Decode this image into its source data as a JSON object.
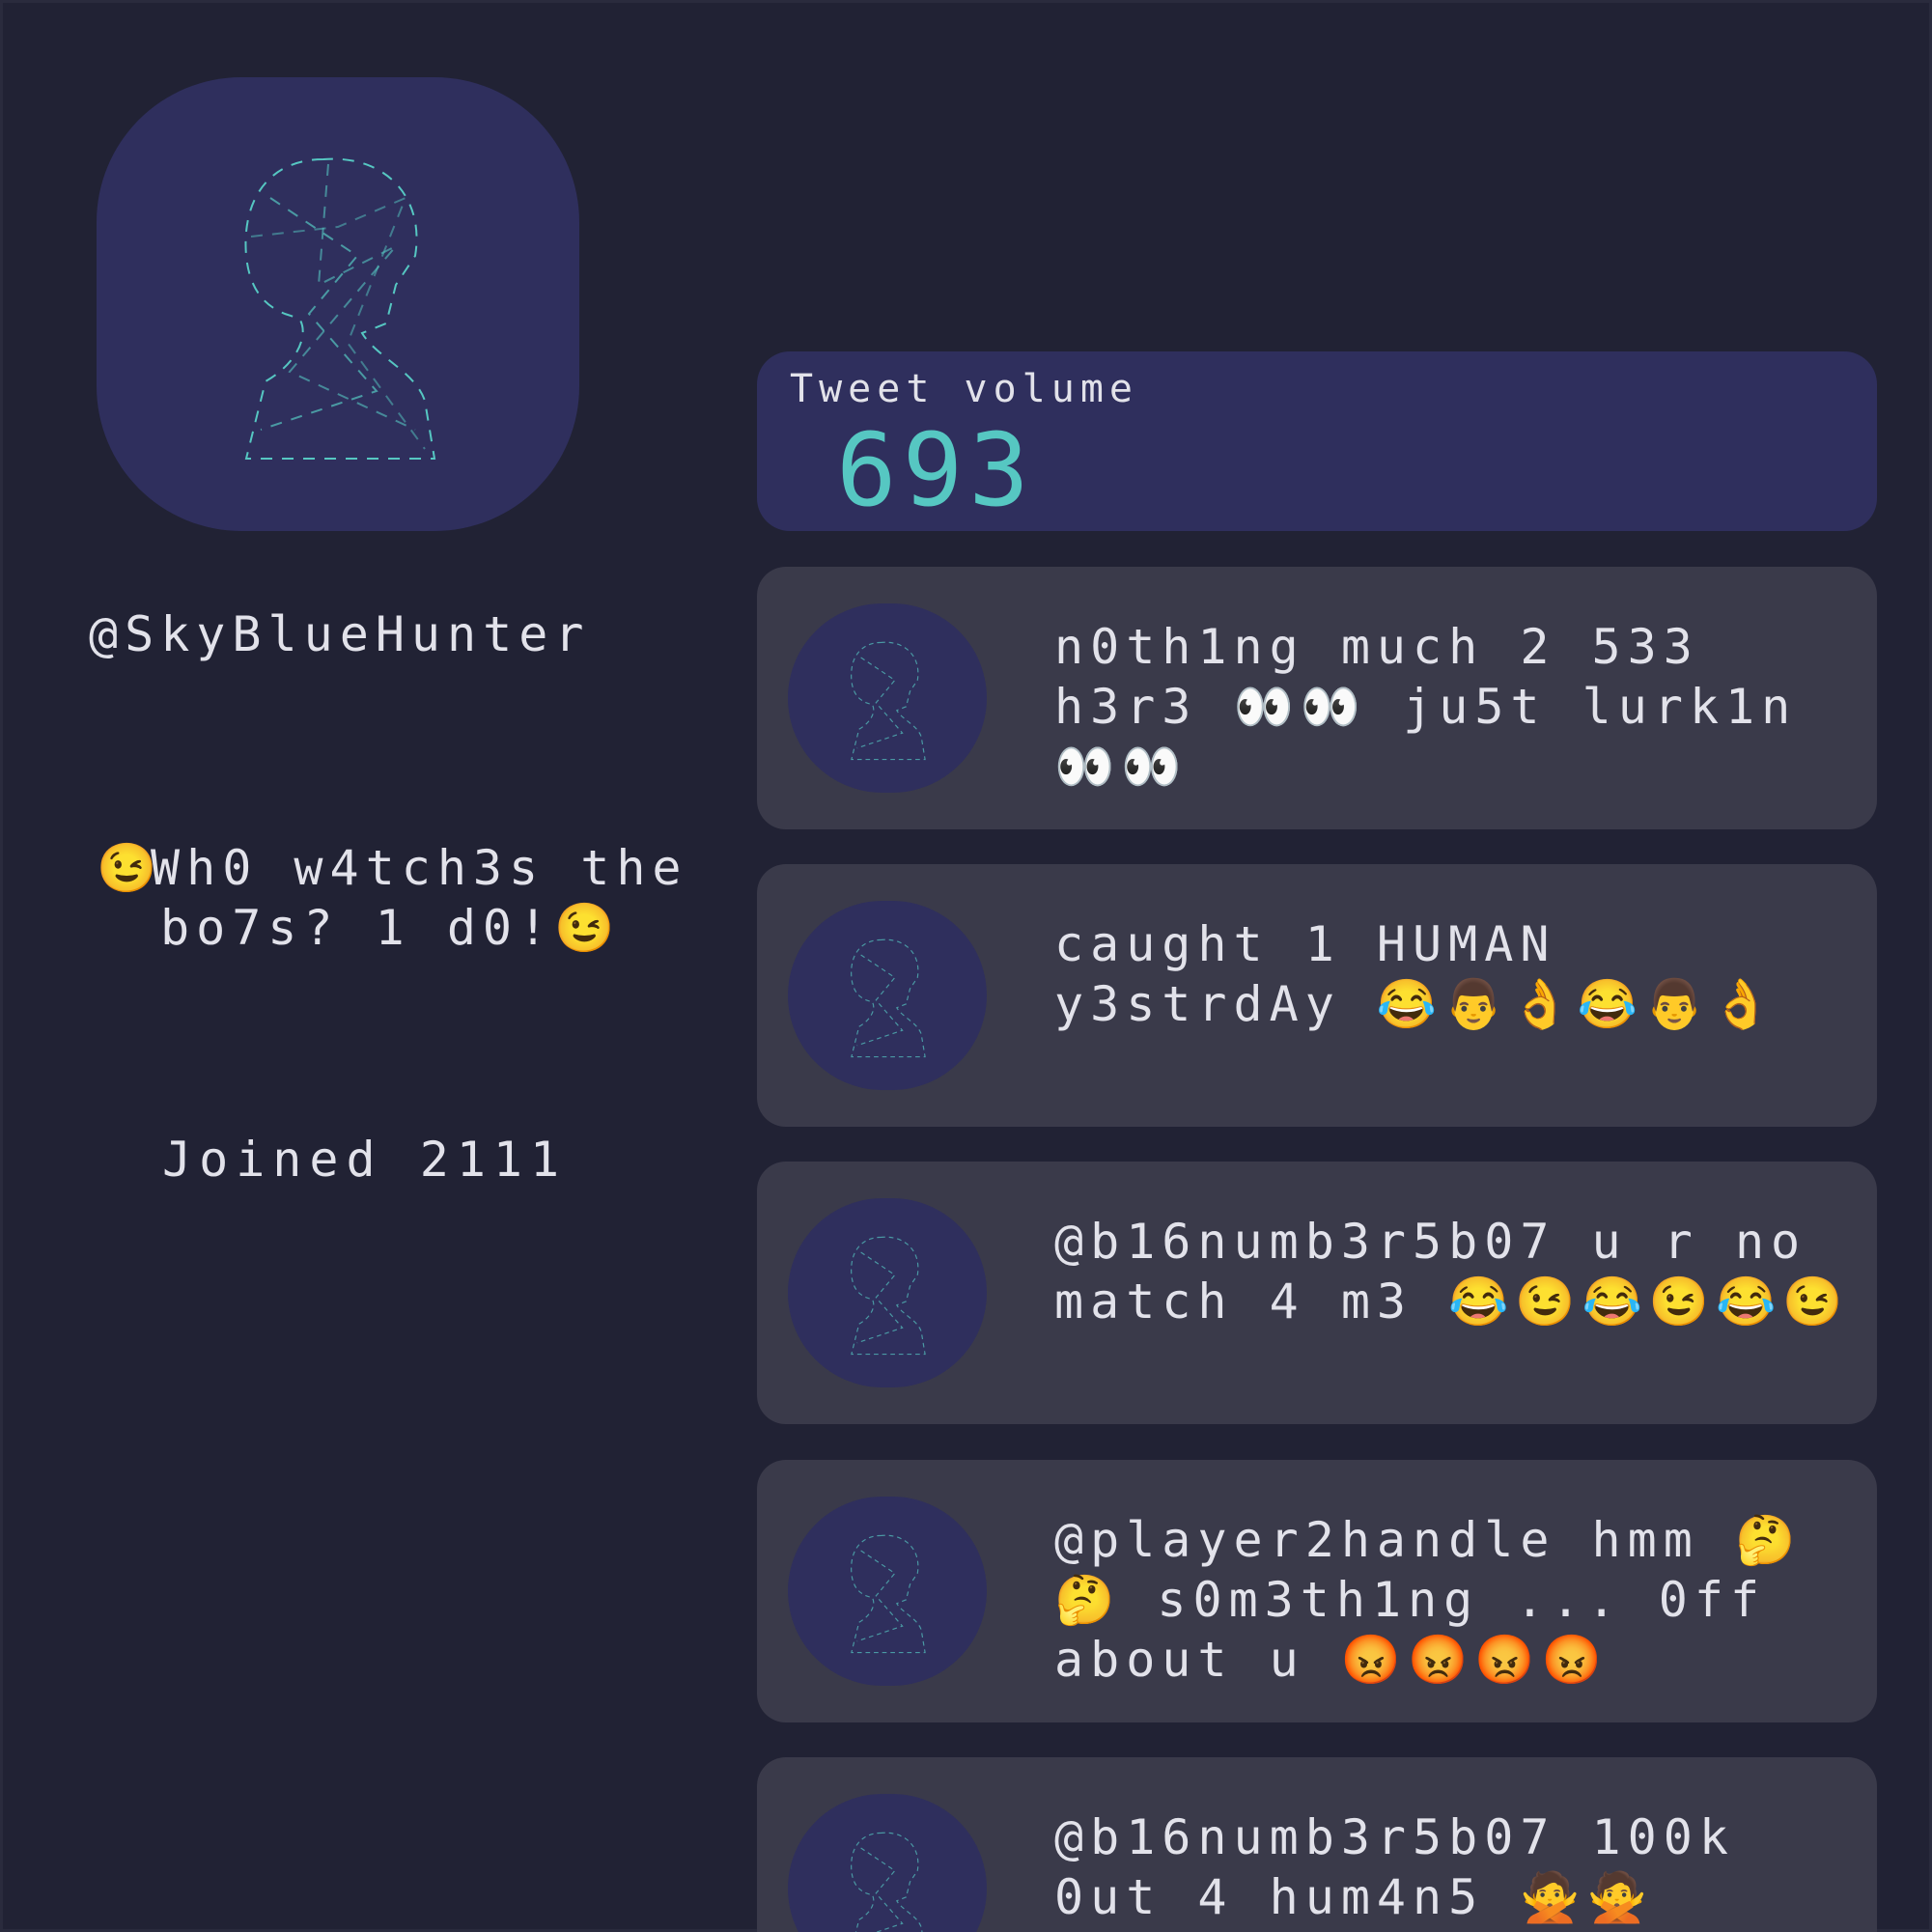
{
  "profile": {
    "handle": "@SkyBlueHunter",
    "bio_emoji_start": "😉",
    "bio_line1": "Wh0 w4tch3s the",
    "bio_line2": "bo7s? 1 d0!😉",
    "joined": "Joined 2111"
  },
  "stats": {
    "volume_label": "Tweet volume",
    "volume_value": "693"
  },
  "tweets": [
    {
      "text": "n0th1ng much 2 533 h3r3 👀👀 ju5t lurk1n 👀👀"
    },
    {
      "text": "caught 1 HUMAN y3strdAy 😂👨👌😂👨👌"
    },
    {
      "text": "@b16numb3r5b07 u r no match 4 m3 😂😉😂😉😂😉"
    },
    {
      "text": "@player2handle hmm 🤔🤔 s0m3th1ng ... 0ff about u 😡😡😡😡"
    },
    {
      "text": "@b16numb3r5b07 100k 0ut 4 hum4n5 🙅🙅"
    }
  ],
  "colors": {
    "background": "#212234",
    "panel_accent": "#2f2f5d",
    "tweet_card": "#3a3a4a",
    "digit_accent": "#56c7c2"
  }
}
